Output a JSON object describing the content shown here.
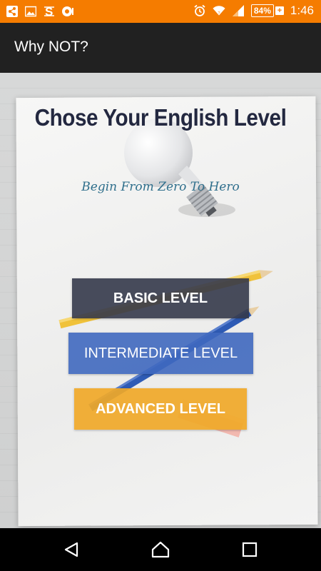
{
  "status_bar": {
    "battery": "84%",
    "battery_charging": "+",
    "time": "1:46",
    "left_icons": [
      "share-icon",
      "image-icon",
      "s-app-icon",
      "circle-app-icon"
    ],
    "right_icons": [
      "alarm-icon",
      "wifi-icon",
      "signal-icon"
    ]
  },
  "app_bar": {
    "title": "Why NOT?"
  },
  "main": {
    "headline": "Chose Your English Level",
    "tagline": "Begin From Zero To Hero",
    "buttons": {
      "basic": "BASIC LEVEL",
      "intermediate": "INTERMEDIATE LEVEL",
      "advanced": "ADVANCED LEVEL"
    }
  },
  "nav_bar": {
    "buttons": [
      "back-icon",
      "home-icon",
      "recents-icon"
    ]
  },
  "colors": {
    "status_bar": "#f57c00",
    "app_bar": "#212121",
    "basic": "#34394a",
    "intermediate": "#3f68bf",
    "advanced": "#f0a828",
    "headline": "#232840",
    "tagline": "#2f6f8c"
  }
}
